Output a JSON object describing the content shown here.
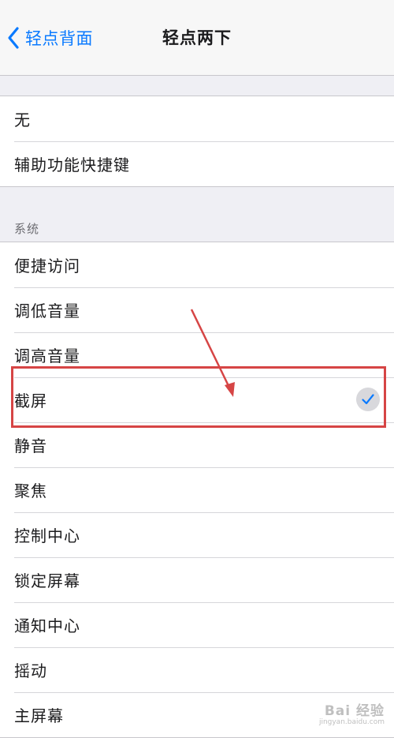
{
  "navbar": {
    "back_label": "轻点背面",
    "title": "轻点两下"
  },
  "group_top": {
    "items": [
      {
        "label": "无"
      },
      {
        "label": "辅助功能快捷键"
      }
    ]
  },
  "system": {
    "header": "系统",
    "items": [
      {
        "label": "便捷访问"
      },
      {
        "label": "调低音量"
      },
      {
        "label": "调高音量"
      },
      {
        "label": "截屏",
        "selected": true
      },
      {
        "label": "静音"
      },
      {
        "label": "聚焦"
      },
      {
        "label": "控制中心"
      },
      {
        "label": "锁定屏幕"
      },
      {
        "label": "通知中心"
      },
      {
        "label": "摇动"
      },
      {
        "label": "主屏幕"
      }
    ]
  },
  "watermark": {
    "brand": "Bai 经验",
    "url": "jingyan.baidu.com"
  },
  "colors": {
    "accent": "#0a7aff",
    "annotation": "#d64545",
    "background": "#efeff4"
  }
}
